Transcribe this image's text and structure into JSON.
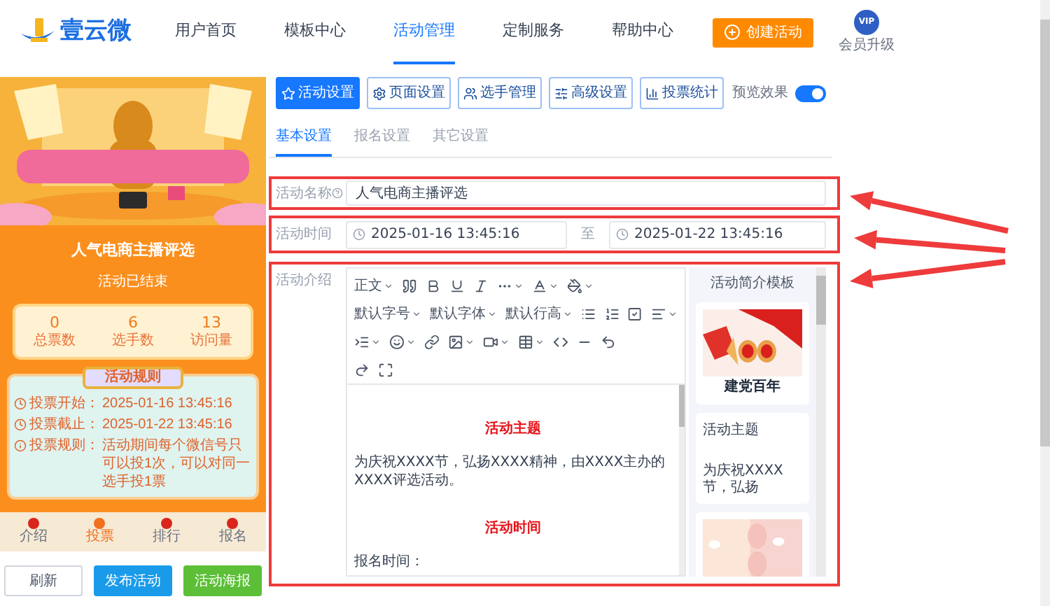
{
  "header": {
    "logo_text": "壹云微",
    "nav": [
      {
        "label": "用户首页",
        "selected": false
      },
      {
        "label": "模板中心",
        "selected": false
      },
      {
        "label": "活动管理",
        "selected": true
      },
      {
        "label": "定制服务",
        "selected": false
      },
      {
        "label": "帮助中心",
        "selected": false
      }
    ],
    "create_button": "创建活动",
    "vip_badge": "VIP",
    "vip_label": "会员升级"
  },
  "preview": {
    "banner": {
      "kind": "picture"
    },
    "title": "人气电商主播评选",
    "status": "活动已结束",
    "stats": [
      {
        "value": "0",
        "label": "总票数"
      },
      {
        "value": "6",
        "label": "选手数"
      },
      {
        "value": "13",
        "label": "访问量"
      }
    ],
    "rules": {
      "title": "活动规则",
      "items": [
        {
          "kind": "clock",
          "label": "投票开始：",
          "value": "2025-01-16 13:45:16"
        },
        {
          "kind": "clock",
          "label": "投票截止：",
          "value": "2025-01-22 13:45:16"
        },
        {
          "kind": "info",
          "label": "投票规则：",
          "value": "活动期间每个微信号只可以投1次，可以对同一选手投1票"
        }
      ]
    },
    "bottom_nav": [
      {
        "label": "介绍",
        "selected": false
      },
      {
        "label": "投票",
        "selected": true
      },
      {
        "label": "排行",
        "selected": false
      },
      {
        "label": "报名",
        "selected": false
      }
    ],
    "actions": [
      {
        "label": "刷新",
        "kind": "default"
      },
      {
        "label": "发布活动",
        "kind": "primary"
      },
      {
        "label": "活动海报",
        "kind": "success"
      }
    ]
  },
  "toolbar": {
    "buttons": [
      {
        "label": "活动设置",
        "selected": true
      },
      {
        "label": "页面设置",
        "selected": false
      },
      {
        "label": "选手管理",
        "selected": false
      },
      {
        "label": "高级设置",
        "selected": false
      },
      {
        "label": "投票统计",
        "selected": false
      }
    ],
    "preview_toggle": {
      "label": "预览效果",
      "on": true
    }
  },
  "tabs": [
    {
      "label": "基本设置",
      "selected": true
    },
    {
      "label": "报名设置",
      "selected": false
    },
    {
      "label": "其它设置",
      "selected": false
    }
  ],
  "form": {
    "name": {
      "label": "活动名称",
      "value": "人气电商主播评选"
    },
    "time": {
      "label": "活动时间",
      "start": "2025-01-16 13:45:16",
      "separator": "至",
      "end": "2025-01-22 13:45:16"
    },
    "intro": {
      "label": "活动介绍",
      "text_menus": [
        "正文",
        "默认字号",
        "默认字体",
        "默认行高"
      ],
      "content": [
        {
          "kind": "heading",
          "text": "活动主题"
        },
        {
          "kind": "paragraph",
          "text": "为庆祝XXXX节，弘扬XXXX精神，由XXXX主办的XXXX评选活动。"
        },
        {
          "kind": "heading",
          "text": "活动时间"
        },
        {
          "kind": "paragraph",
          "text": "报名时间："
        }
      ],
      "templates": {
        "title": "活动简介模板",
        "items": [
          {
            "kind": "picture",
            "caption": "建党百年"
          },
          {
            "kind": "text",
            "title": "活动主题",
            "body": "为庆祝XXXX节，弘扬"
          },
          {
            "kind": "picture"
          }
        ]
      }
    }
  }
}
